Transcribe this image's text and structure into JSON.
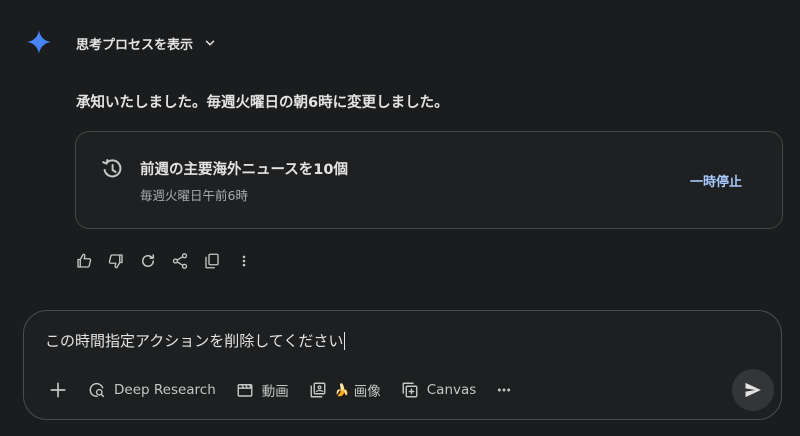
{
  "thinking": {
    "label": "思考プロセスを表示",
    "icon": "chevron-down-icon"
  },
  "response": {
    "text": "承知いたしました。毎週火曜日の朝6時に変更しました。"
  },
  "scheduled_card": {
    "title": "前週の主要海外ニュースを10個",
    "schedule": "毎週火曜日午前6時",
    "pause_label": "一時停止",
    "icon": "schedule-history-icon"
  },
  "actions": [
    {
      "name": "thumbs-up-icon"
    },
    {
      "name": "thumbs-down-icon"
    },
    {
      "name": "regenerate-icon"
    },
    {
      "name": "share-icon"
    },
    {
      "name": "copy-icon"
    },
    {
      "name": "more-vert-icon"
    }
  ],
  "composer": {
    "value": "この時間指定アクションを削除してください",
    "tools": {
      "deep_research": "Deep Research",
      "video": "動画",
      "image": "画像",
      "canvas": "Canvas"
    }
  },
  "colors": {
    "background": "#1b1c1d",
    "accent": "#a8c7fa",
    "gemini_blue": "#4285f4"
  }
}
